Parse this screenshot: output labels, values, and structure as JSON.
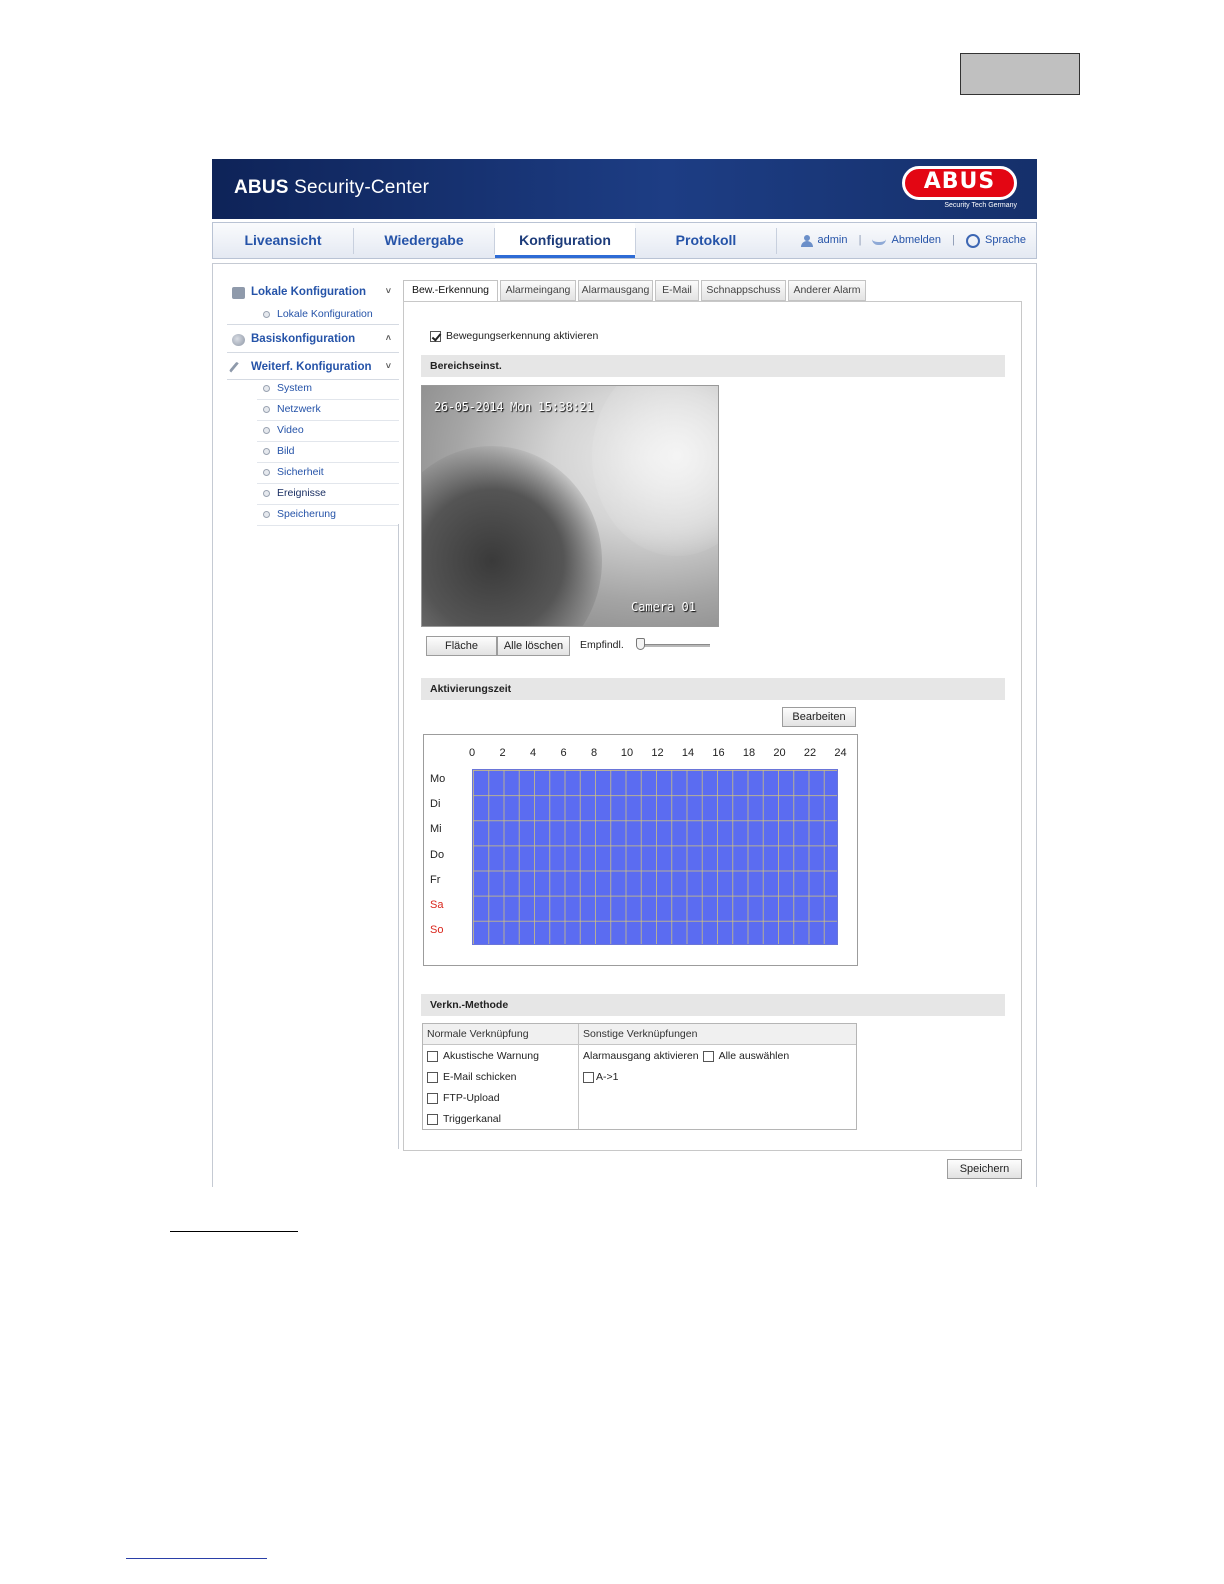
{
  "app": {
    "title_bold": "ABUS",
    "title_rest": " Security-Center",
    "logo_text": "ABUS",
    "logo_subtitle": "Security Tech Germany"
  },
  "nav": {
    "tabs": [
      {
        "label": "Liveansicht"
      },
      {
        "label": "Wiedergabe"
      },
      {
        "label": "Konfiguration",
        "active": true
      },
      {
        "label": "Protokoll"
      }
    ],
    "user": "admin",
    "logout": "Abmelden",
    "language": "Sprache",
    "separator": "|"
  },
  "sidebar": {
    "groups": [
      {
        "label": "Lokale Konfiguration",
        "chevron": "˅",
        "items": [
          "Lokale Konfiguration"
        ]
      },
      {
        "label": "Basiskonfiguration",
        "chevron": "˄"
      },
      {
        "label": "Weiterf. Konfiguration",
        "chevron": "˅"
      }
    ],
    "items": [
      "System",
      "Netzwerk",
      "Video",
      "Bild",
      "Sicherheit",
      "Ereignisse",
      "Speicherung"
    ],
    "active_item": "Ereignisse"
  },
  "tabs": [
    "Bew.-Erkennung",
    "Alarmeingang",
    "Alarmausgang",
    "E-Mail",
    "Schnappschuss",
    "Anderer Alarm"
  ],
  "active_tab": "Bew.-Erkennung",
  "motion": {
    "enable_label": "Bewegungserkennung aktivieren",
    "enabled": true,
    "area_section": "Bereichseinst.",
    "osd_time": "26-05-2014 Mon 15:38:21",
    "osd_camera": "Camera 01",
    "area_button": "Fläche",
    "clear_button": "Alle löschen",
    "sensitivity_label": "Empfindl.",
    "sensitivity_level": 0
  },
  "schedule": {
    "section": "Aktivierungszeit",
    "edit_button": "Bearbeiten",
    "hours": [
      "0",
      "2",
      "4",
      "6",
      "8",
      "10",
      "12",
      "14",
      "16",
      "18",
      "20",
      "22",
      "24"
    ],
    "days": [
      "Mo",
      "Di",
      "Mi",
      "Do",
      "Fr",
      "Sa",
      "So"
    ],
    "weekend_color": "#d9261c",
    "fill_color": "#5b6cf1"
  },
  "linking": {
    "section": "Verkn.-Methode",
    "normal_header": "Normale Verknüpfung",
    "other_header": "Sonstige Verknüpfungen",
    "normal_options": [
      "Akustische Warnung",
      "E-Mail schicken",
      "FTP-Upload",
      "Triggerkanal"
    ],
    "alarm_output_label": "Alarmausgang aktivieren",
    "select_all_label": "Alle auswählen",
    "output_option": "A->1"
  },
  "save_button": "Speichern"
}
